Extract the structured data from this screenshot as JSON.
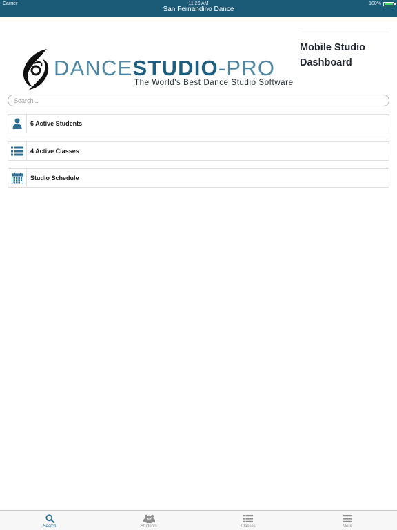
{
  "status_bar": {
    "carrier": "Carrier",
    "time": "11:26 AM",
    "battery": "100%",
    "battery_level": 1.0
  },
  "header": {
    "title": "San Fernandino Dance"
  },
  "dashboard": {
    "title": "Mobile Studio Dashboard"
  },
  "logo": {
    "word_light": "DANCE",
    "word_bold": "STUDIO",
    "word_suffix": "-PRO",
    "tagline": "The World's Best Dance Studio Software",
    "icon": "dancer-logo-icon"
  },
  "search": {
    "placeholder": "Search..."
  },
  "items": [
    {
      "label": "6 Active Students",
      "icon": "person-icon"
    },
    {
      "label": "4 Active Classes",
      "icon": "list-icon"
    },
    {
      "label": "Studio Schedule",
      "icon": "calendar-icon"
    }
  ],
  "tabs": [
    {
      "label": "Search",
      "icon": "search-icon",
      "active": true
    },
    {
      "label": "Students",
      "icon": "group-icon",
      "active": false
    },
    {
      "label": "Classes",
      "icon": "list-icon",
      "active": false
    },
    {
      "label": "More",
      "icon": "menu-icon",
      "active": false
    }
  ],
  "colors": {
    "navbar": "#1b5b78",
    "accent": "#2d6e92",
    "tab_inactive": "#8e8e8e"
  }
}
